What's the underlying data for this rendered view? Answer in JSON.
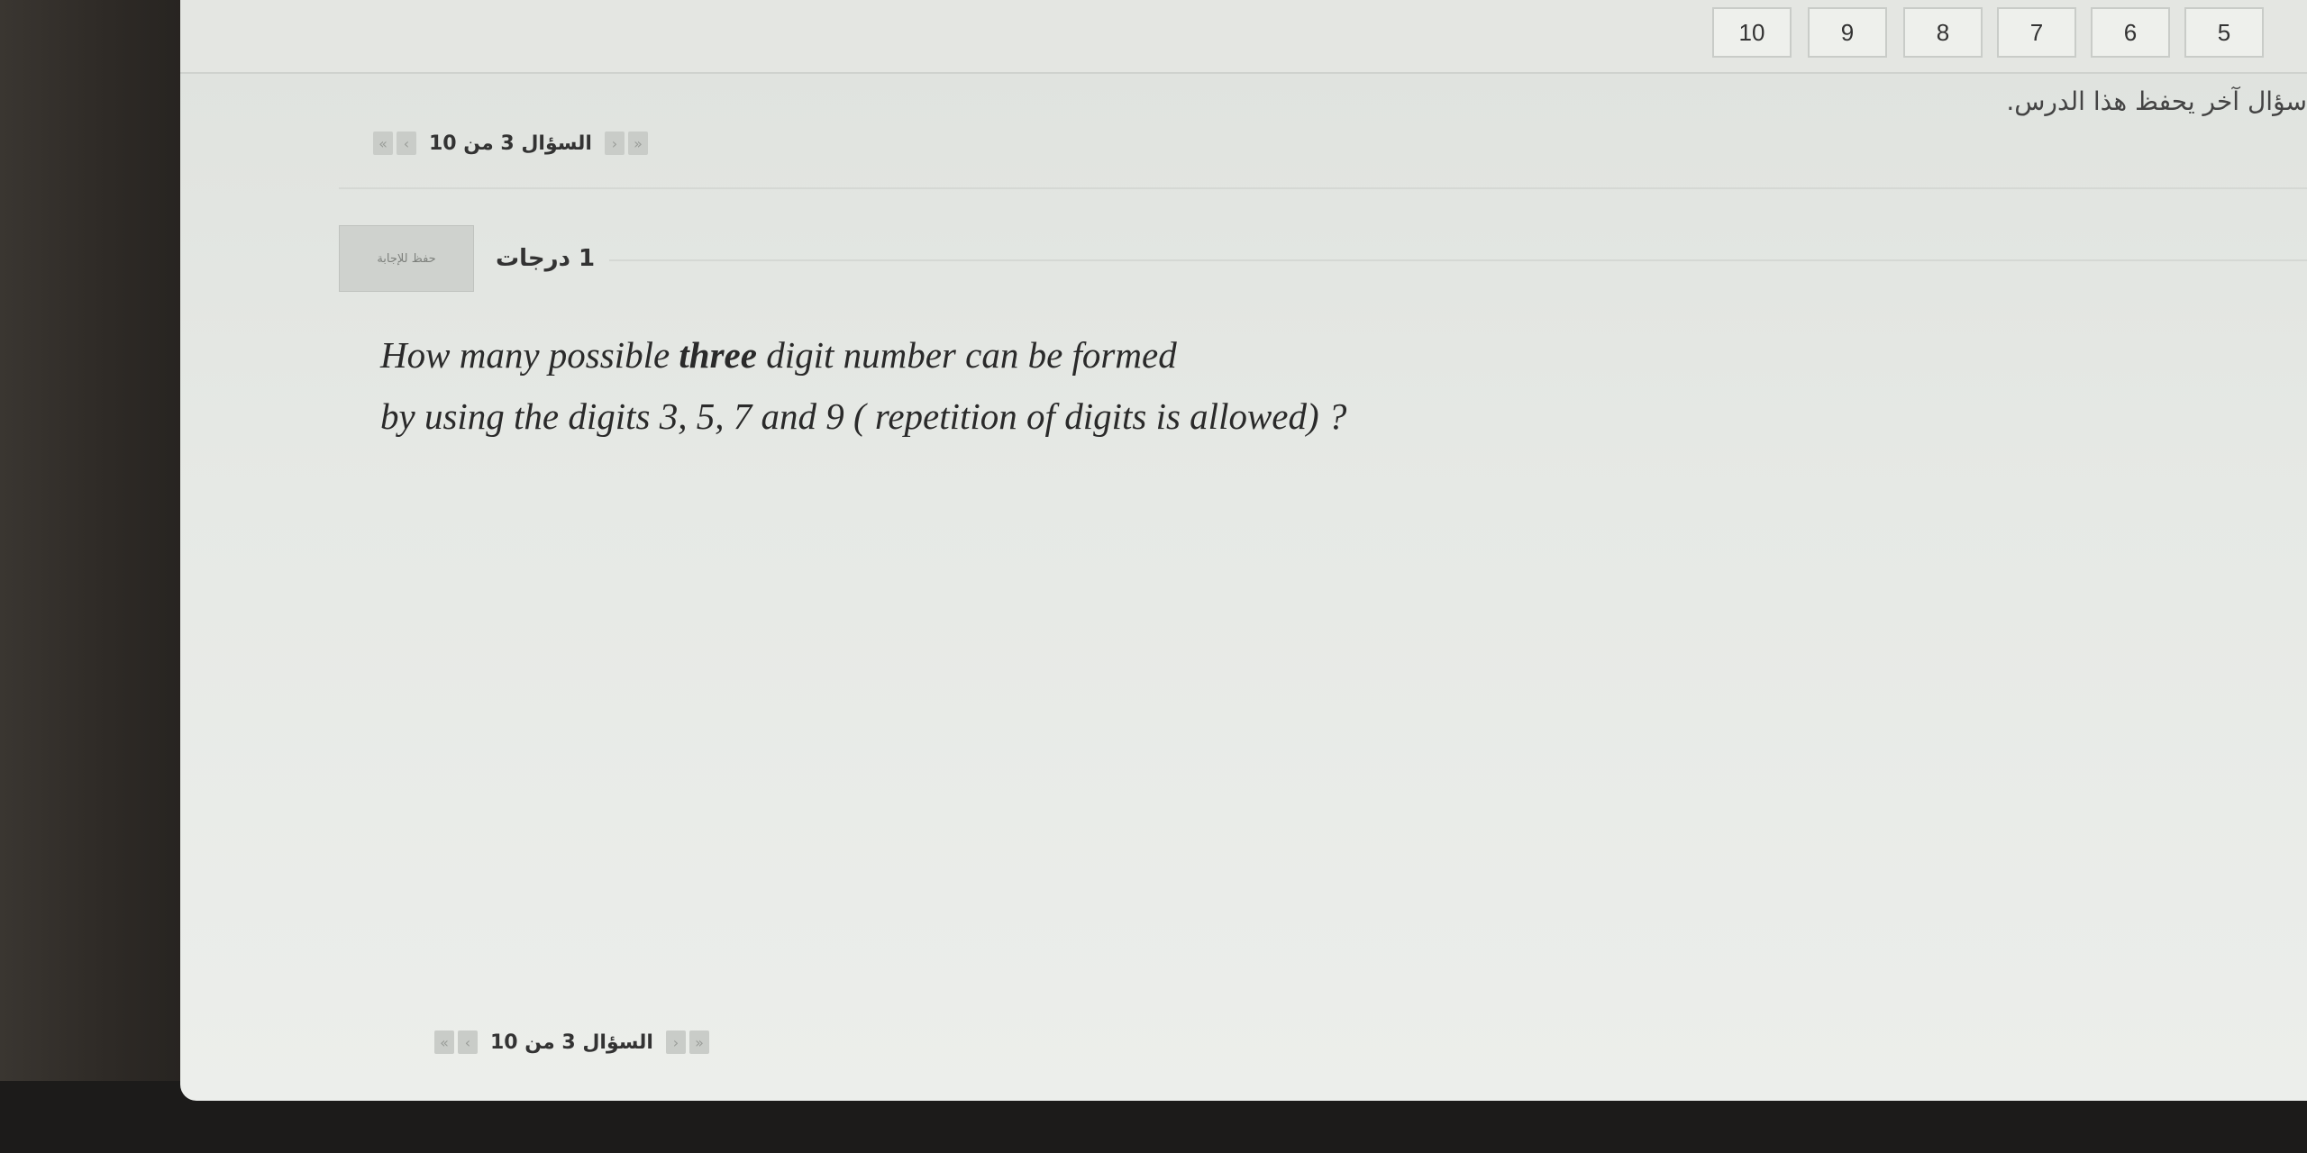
{
  "question_nav": {
    "numbers": [
      "10",
      "9",
      "8",
      "7",
      "6",
      "5"
    ]
  },
  "flag_hint": "سؤال آخر يحفظ هذا الدرس.",
  "pager_top": {
    "label": "السؤال 3 من 10",
    "first": "«",
    "prev": "‹",
    "next": "›",
    "last": "»"
  },
  "question_meta": {
    "marks": "1 درجات",
    "flag_label": "حفظ للإجابة"
  },
  "question": {
    "line1_before": "How many possible ",
    "line1_bold": "three",
    "line1_after": " digit number can be formed",
    "line2": "by using the digits  3, 5, 7 and  9 ( repetition of digits is allowed) ?"
  },
  "pager_bottom": {
    "label": "السؤال 3 من 10",
    "first": "«",
    "prev": "‹",
    "next": "›",
    "last": "»"
  }
}
